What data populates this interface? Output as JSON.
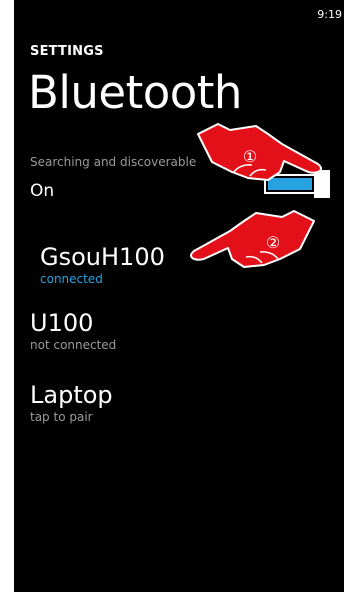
{
  "status_bar": {
    "time": "9:19"
  },
  "header": {
    "app_title": "SETTINGS",
    "page_title": "Bluetooth"
  },
  "toggle": {
    "caption": "Searching and discoverable",
    "state": "On",
    "is_on": true
  },
  "devices": [
    {
      "name": "GsouH100",
      "status": "connected"
    },
    {
      "name": "U100",
      "status": "not connected"
    },
    {
      "name": "Laptop",
      "status": "tap to pair"
    }
  ],
  "annotations": [
    {
      "marker": "①"
    },
    {
      "marker": "②"
    }
  ],
  "colors": {
    "background": "#000000",
    "accent": "#27a1e0",
    "pointer": "#e3101a",
    "secondary_text": "#9a9a9a"
  }
}
